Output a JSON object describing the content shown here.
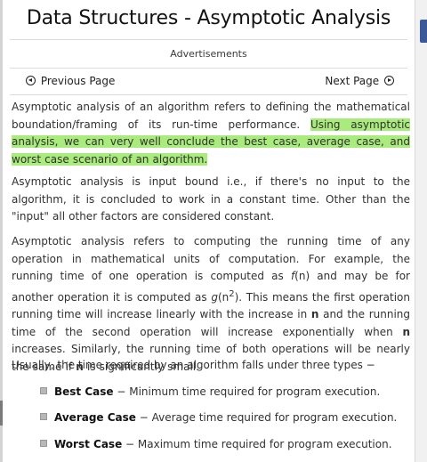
{
  "page": {
    "title": "Data Structures - Asymptotic Analysis",
    "ads_label": "Advertisements"
  },
  "nav": {
    "previous": "Previous Page",
    "next": "Next Page"
  },
  "paragraphs": {
    "p1_a": "Asymptotic analysis of an algorithm refers to defining the mathematical boundation/framing of its run-time performance. ",
    "p1_b": "Using asymptotic analysis, we can very well conclude the best case, average case, and worst case scenario of an algorithm.",
    "p2": "Asymptotic analysis is input bound i.e., if there's no input to the algorithm, it is concluded to work in a constant time. Other than the \"input\" all other factors are considered constant.",
    "p3_1": "Asymptotic analysis refers to computing the running time of any operation in mathematical units of computation. For example, the running time of one operation is computed as ",
    "p3_f": "f",
    "p3_2": "(n) and may be for another operation it is computed as ",
    "p3_g": "g",
    "p3_3": "(n",
    "p3_sup": "2",
    "p3_4": "). This means the first operation running time will increase linearly with the increase in ",
    "p3_n1": "n",
    "p3_5": " and the running time of the second operation will increase exponentially when ",
    "p3_n2": "n",
    "p3_6": " increases. Similarly, the running time of both operations will be nearly the same if ",
    "p3_n3": "n",
    "p3_7": " is significantly small.",
    "list_intro": "Usually, the time required by an algorithm falls under three types −"
  },
  "types": [
    {
      "name": "Best Case",
      "desc": " − Minimum time required for program execution."
    },
    {
      "name": "Average Case",
      "desc": " − Average time required for program execution."
    },
    {
      "name": "Worst Case",
      "desc": " − Maximum time required for program execution."
    }
  ],
  "colors": {
    "highlight": "#a9ec7d",
    "share_tab": "#3b5998"
  }
}
